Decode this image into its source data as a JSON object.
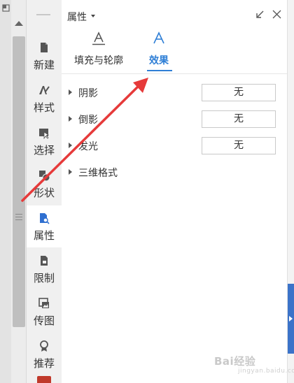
{
  "sidebar": {
    "tools": [
      {
        "label": "新建",
        "icon": "new-doc-icon"
      },
      {
        "label": "样式",
        "icon": "style-brush-icon"
      },
      {
        "label": "选择",
        "icon": "select-cursor-icon"
      },
      {
        "label": "形状",
        "icon": "shape-icon"
      },
      {
        "label": "属性",
        "icon": "properties-icon"
      },
      {
        "label": "限制",
        "icon": "restrict-doc-icon"
      },
      {
        "label": "传图",
        "icon": "upload-image-icon"
      },
      {
        "label": "推荐",
        "icon": "recommend-badge-icon"
      }
    ],
    "active_tool": "属性"
  },
  "panel": {
    "title": "属性",
    "tabs": [
      {
        "label": "填充与轮廓",
        "icon": "fill-outline-A-icon"
      },
      {
        "label": "效果",
        "icon": "effect-A-icon"
      }
    ],
    "active_tab": "效果",
    "sections": [
      {
        "label": "阴影",
        "value": "无"
      },
      {
        "label": "倒影",
        "value": "无"
      },
      {
        "label": "发光",
        "value": "无"
      },
      {
        "label": "三维格式"
      }
    ]
  },
  "watermark": {
    "text": "Bai",
    "text2": "经验",
    "sub": "jingyan.baidu.com"
  },
  "colors": {
    "accent": "#2f7fd6",
    "annotation_arrow": "#e63a3a",
    "edge_tab": "#3b73c9"
  }
}
